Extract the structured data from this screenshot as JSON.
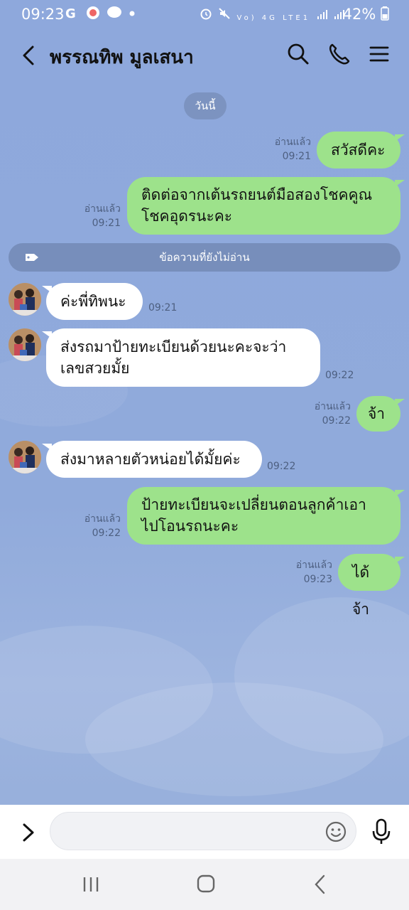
{
  "status_bar": {
    "time": "09:23",
    "left_icons": "G",
    "network": "Vo) 4G LTE1",
    "battery": "42%"
  },
  "header": {
    "title": "พรรณทิพ มูลเสนา",
    "icons": [
      "back-arrow-icon",
      "search-icon",
      "phone-icon",
      "menu-icon"
    ]
  },
  "date_label": "วันนี้",
  "unread_label": "ข้อความที่ยังไม่อ่าน",
  "messages": [
    {
      "side": "sent",
      "text": "สวัสดีคะ",
      "read": "อ่านแล้ว",
      "time": "09:21"
    },
    {
      "side": "sent",
      "text": "ติดต่อจากเต้นรถยนต์มือสองโชคคูณ โชคอุดรนะคะ",
      "line1": "ติดต่อจากเต้นรถยนต์มือสองโชคคูณ",
      "line2": "โชคอุดรนะคะ",
      "read": "อ่านแล้ว",
      "time": "09:21"
    },
    {
      "side": "recv",
      "text": "ค่ะพี่ทิพนะ",
      "time": "09:21"
    },
    {
      "side": "recv",
      "text": "ส่งรถมาป้ายทะเบียนด้วยนะคะจะว่า เลขสวยมั้ย",
      "line1": "ส่งรถมาป้ายทะเบียนด้วยนะคะจะว่า",
      "line2": "เลขสวยมั้ย",
      "time": "09:22"
    },
    {
      "side": "sent",
      "text": "จ้า",
      "read": "อ่านแล้ว",
      "time": "09:22"
    },
    {
      "side": "recv",
      "text": "ส่งมาหลายตัวหน่อยได้มั้ยค่ะ",
      "time": "09:22"
    },
    {
      "side": "sent",
      "text": "ป้ายทะเบียนจะเปลี่ยนตอนลูกค้าเอา ไปโอนรถนะคะ",
      "line1": "ป้ายทะเบียนจะเปลี่ยนตอนลูกค้าเอา",
      "line2": "ไปโอนรถนะคะ",
      "read": "อ่านแล้ว",
      "time": "09:22"
    },
    {
      "side": "sent",
      "text": "ได้จ้า",
      "read": "อ่านแล้ว",
      "time": "09:23"
    }
  ],
  "input": {
    "value": "",
    "placeholder": ""
  },
  "colors": {
    "sent_bubble": "#9de28b",
    "recv_bubble": "#ffffff",
    "background": "#8fa9d9"
  }
}
